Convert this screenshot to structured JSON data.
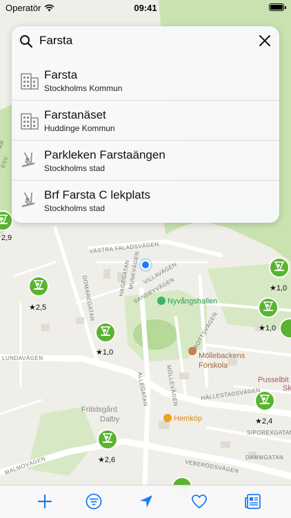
{
  "status": {
    "carrier": "Operatör",
    "time": "09:41"
  },
  "search": {
    "query": "Farsta"
  },
  "results": [
    {
      "title": "Farsta",
      "subtitle": "Stockholms Kommun",
      "icon": "building-icon"
    },
    {
      "title": "Farstanäset",
      "subtitle": "Huddinge Kommun",
      "icon": "building-icon"
    },
    {
      "title": "Parkleken Farstaängen",
      "subtitle": "Stockholms stad",
      "icon": "swing-icon"
    },
    {
      "title": "Brf Farsta C lekplats",
      "subtitle": "Stockholms stad",
      "icon": "swing-icon"
    }
  ],
  "map": {
    "streets": {
      "vastra_faladsvagen": "VÄSTRA FALADSVÄGEN",
      "munkvagen": "MUNKVÄGEN",
      "hagegatan": "HAGEGATAN",
      "domaregatan": "DOMAREGATAN",
      "villavagen": "VILLAVÄGEN",
      "sandbyvagen": "SANDBYVÄGEN",
      "drottsvagen": "DROTTSVÄGEN",
      "lundavagen": "LUNDAVÄGEN",
      "allegatan": "ALLEGATAN",
      "mollevagen": "MÖLLEVÄGEN",
      "hallestadsvagen": "HÄLLESTADSVÄGEN",
      "siporexgatan": "SIPOREXGATAN",
      "malmovagen": "MALMÖVÄGEN",
      "veberodsvagen": "VEBERÖDSVÄGEN",
      "dammgatan": "DAMMGATAN"
    },
    "pois": {
      "nyvangshallen": "Nyvångshallen",
      "mollebackens_forskola_1": "Möllebackens",
      "mollebackens_forskola_2": "Förskola",
      "pusselbit_1": "Pusselbit",
      "pusselbit_2": "Sk",
      "fritidsgard_1": "Fritidsgård",
      "fritidsgard_2": "Dalby",
      "hemkop": "Hemköp"
    },
    "pins": [
      {
        "rating": "★2,9",
        "icon": "swing-icon"
      },
      {
        "rating": "★2,5",
        "icon": "swing-icon"
      },
      {
        "rating": "★1,0",
        "icon": "swing-icon"
      },
      {
        "rating": "★1,0",
        "icon": "swing-icon"
      },
      {
        "rating": "★1,0",
        "icon": "swing-icon"
      },
      {
        "rating": "★2,4",
        "icon": "swing-icon"
      },
      {
        "rating": "★2,6",
        "icon": "swing-icon"
      }
    ],
    "edge_labels": {
      "top_left_1": "RR",
      "top_left_2": "ESV"
    },
    "colors": {
      "pin": "#5ab432",
      "location": "#1a7cf5",
      "park": "#c9e3b0",
      "accent": "#1a7cf5"
    }
  },
  "toolbar": {
    "items": [
      {
        "icon": "plus-icon"
      },
      {
        "icon": "filter-icon"
      },
      {
        "icon": "location-arrow-icon"
      },
      {
        "icon": "heart-icon"
      },
      {
        "icon": "news-icon"
      }
    ]
  }
}
